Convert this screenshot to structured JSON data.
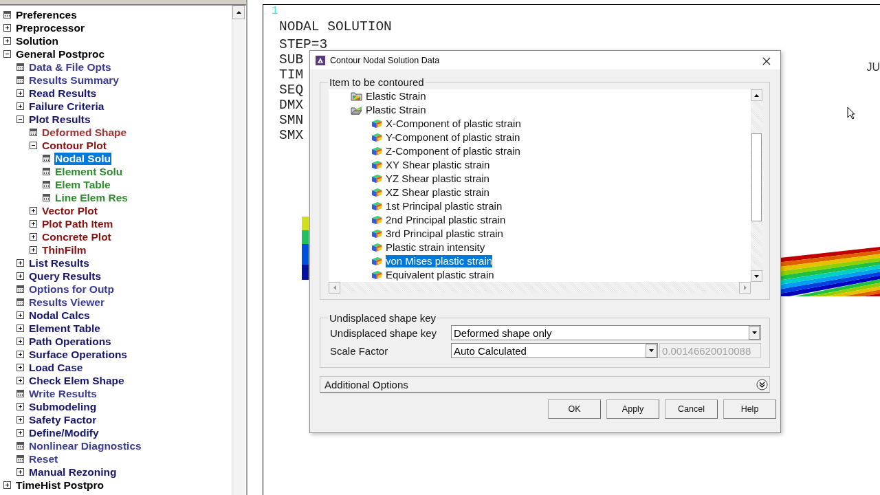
{
  "main_menu": {
    "items": [
      {
        "label": "Preferences",
        "kind": "action",
        "color": "#000000",
        "selected": false
      },
      {
        "label": "Preprocessor",
        "kind": "group",
        "expanded": false,
        "color": "#000000",
        "selected": false
      },
      {
        "label": "Solution",
        "kind": "group",
        "expanded": false,
        "color": "#000000",
        "selected": false
      },
      {
        "label": "General Postproc",
        "kind": "group",
        "expanded": true,
        "color": "#000000",
        "selected": false,
        "children": [
          {
            "label": "Data & File Opts",
            "kind": "action",
            "color": "#3b3b95",
            "selected": false
          },
          {
            "label": "Results Summary",
            "kind": "action",
            "color": "#3b3b95",
            "selected": false
          },
          {
            "label": "Read Results",
            "kind": "group",
            "expanded": false,
            "color": "#16166e",
            "selected": false
          },
          {
            "label": "Failure Criteria",
            "kind": "group",
            "expanded": false,
            "color": "#16166e",
            "selected": false
          },
          {
            "label": "Plot Results",
            "kind": "group",
            "expanded": true,
            "color": "#16166e",
            "selected": false,
            "children": [
              {
                "label": "Deformed Shape",
                "kind": "action",
                "color": "#a03232",
                "selected": false
              },
              {
                "label": "Contour Plot",
                "kind": "group",
                "expanded": true,
                "color": "#8b1010",
                "selected": false,
                "children": [
                  {
                    "label": "Nodal Solu",
                    "kind": "action",
                    "selected": true
                  },
                  {
                    "label": "Element Solu",
                    "kind": "action",
                    "color": "#2e8b2e",
                    "selected": false
                  },
                  {
                    "label": "Elem Table",
                    "kind": "action",
                    "color": "#2e8b2e",
                    "selected": false
                  },
                  {
                    "label": "Line Elem Res",
                    "kind": "action",
                    "color": "#2e8b2e",
                    "selected": false
                  }
                ]
              },
              {
                "label": "Vector Plot",
                "kind": "group",
                "expanded": false,
                "color": "#8b1010",
                "selected": false
              },
              {
                "label": "Plot Path Item",
                "kind": "group",
                "expanded": false,
                "color": "#8b1010",
                "selected": false
              },
              {
                "label": "Concrete Plot",
                "kind": "group",
                "expanded": false,
                "color": "#8b1010",
                "selected": false
              },
              {
                "label": "ThinFilm",
                "kind": "group",
                "expanded": false,
                "color": "#8b1010",
                "selected": false
              }
            ]
          },
          {
            "label": "List Results",
            "kind": "group",
            "expanded": false,
            "color": "#16166e",
            "selected": false
          },
          {
            "label": "Query Results",
            "kind": "group",
            "expanded": false,
            "color": "#16166e",
            "selected": false
          },
          {
            "label": "Options for Outp",
            "kind": "action",
            "color": "#3b3b95",
            "selected": false
          },
          {
            "label": "Results Viewer",
            "kind": "action",
            "color": "#3b3b95",
            "selected": false
          },
          {
            "label": "Nodal Calcs",
            "kind": "group",
            "expanded": false,
            "color": "#16166e",
            "selected": false
          },
          {
            "label": "Element Table",
            "kind": "group",
            "expanded": false,
            "color": "#16166e",
            "selected": false
          },
          {
            "label": "Path Operations",
            "kind": "group",
            "expanded": false,
            "color": "#16166e",
            "selected": false
          },
          {
            "label": "Surface Operations",
            "kind": "group",
            "expanded": false,
            "color": "#16166e",
            "selected": false
          },
          {
            "label": "Load Case",
            "kind": "group",
            "expanded": false,
            "color": "#16166e",
            "selected": false
          },
          {
            "label": "Check Elem Shape",
            "kind": "group",
            "expanded": false,
            "color": "#16166e",
            "selected": false
          },
          {
            "label": "Write Results",
            "kind": "action",
            "color": "#3b3b95",
            "selected": false
          },
          {
            "label": "Submodeling",
            "kind": "group",
            "expanded": false,
            "color": "#16166e",
            "selected": false
          },
          {
            "label": "Safety Factor",
            "kind": "group",
            "expanded": false,
            "color": "#16166e",
            "selected": false
          },
          {
            "label": "Define/Modify",
            "kind": "group",
            "expanded": false,
            "color": "#16166e",
            "selected": false
          },
          {
            "label": "Nonlinear Diagnostics",
            "kind": "action",
            "color": "#3b3b95",
            "selected": false
          },
          {
            "label": "Reset",
            "kind": "action",
            "color": "#3b3b95",
            "selected": false
          },
          {
            "label": "Manual Rezoning",
            "kind": "group",
            "expanded": false,
            "color": "#16166e",
            "selected": false
          }
        ]
      },
      {
        "label": "TimeHist Postpro",
        "kind": "group",
        "expanded": false,
        "color": "#000000",
        "selected": false
      }
    ]
  },
  "graphics": {
    "plot_number": "1",
    "title": "NODAL SOLUTION",
    "lines": [
      "STEP=3",
      "SUB",
      "TIM",
      "SEQ",
      "DMX",
      "SMN",
      "SMX"
    ],
    "corner_text": "JU"
  },
  "dialog": {
    "title": "Contour Nodal Solution Data",
    "item_group": {
      "title": "Item to be contoured",
      "tree": [
        {
          "label": "Elastic Strain",
          "kind": "folder",
          "expanded": false,
          "selected": false
        },
        {
          "label": "Plastic Strain",
          "kind": "folder",
          "expanded": true,
          "selected": false,
          "children": [
            {
              "label": "X-Component of plastic strain",
              "kind": "result",
              "selected": false
            },
            {
              "label": "Y-Component of plastic strain",
              "kind": "result",
              "selected": false
            },
            {
              "label": "Z-Component of plastic strain",
              "kind": "result",
              "selected": false
            },
            {
              "label": "XY Shear plastic strain",
              "kind": "result",
              "selected": false
            },
            {
              "label": "YZ Shear plastic strain",
              "kind": "result",
              "selected": false
            },
            {
              "label": "XZ Shear plastic strain",
              "kind": "result",
              "selected": false
            },
            {
              "label": "1st Principal plastic strain",
              "kind": "result",
              "selected": false
            },
            {
              "label": "2nd Principal plastic strain",
              "kind": "result",
              "selected": false
            },
            {
              "label": "3rd Principal plastic strain",
              "kind": "result",
              "selected": false
            },
            {
              "label": "Plastic strain intensity",
              "kind": "result",
              "selected": false
            },
            {
              "label": "von Mises plastic strain",
              "kind": "result",
              "selected": true
            },
            {
              "label": "Equivalent plastic strain",
              "kind": "result",
              "selected": false
            }
          ]
        }
      ]
    },
    "shape_group": {
      "title": "Undisplaced shape key",
      "rows": [
        {
          "label": "Undisplaced shape key",
          "kind": "select",
          "value": "Deformed shape only"
        },
        {
          "label": "Scale Factor",
          "kind": "select_with_field",
          "value": "Auto Calculated",
          "field_value": "0.00146620010088",
          "field_disabled": true
        }
      ]
    },
    "additional_options": {
      "label": "Additional Options",
      "expanded": false
    },
    "buttons": [
      "OK",
      "Apply",
      "Cancel",
      "Help"
    ]
  }
}
